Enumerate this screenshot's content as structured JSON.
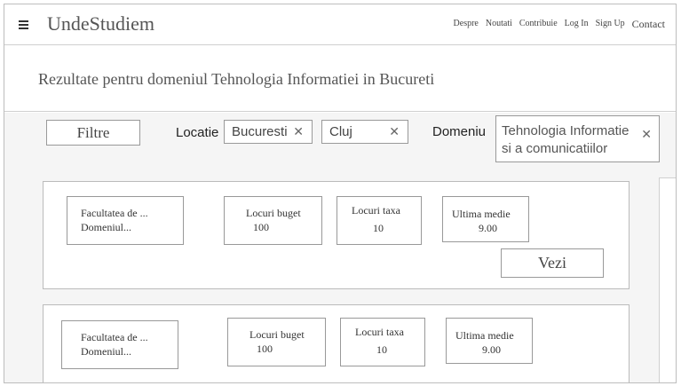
{
  "header": {
    "logo": "UndeStudiem",
    "nav": [
      "Despre",
      "Noutati",
      "Contribuie",
      "Log In",
      "Sign Up",
      "Contact"
    ]
  },
  "results_title": "Rezultate pentru domeniul Tehnologia Informatiei in Bucureti",
  "filters": {
    "button_label": "Filtre",
    "location_label": "Locatie",
    "locations": [
      "Bucuresti",
      "Cluj"
    ],
    "domain_label": "Domeniu",
    "domain_line1": "Tehnologia Informatie",
    "domain_line2": "si a comunicatiilor",
    "remove_glyph": "✕"
  },
  "cards": [
    {
      "faculty_line1": "Facultatea de ...",
      "faculty_line2": "Domeniul...",
      "budget_label": "Locuri buget",
      "budget_value": "100",
      "tax_label": "Locuri taxa",
      "tax_value": "10",
      "avg_label": "Ultima medie",
      "avg_value": "9.00",
      "view_label": "Vezi"
    },
    {
      "faculty_line1": "Facultatea de ...",
      "faculty_line2": "Domeniul...",
      "budget_label": "Locuri buget",
      "budget_value": "100",
      "tax_label": "Locuri taxa",
      "tax_value": "10",
      "avg_label": "Ultima medie",
      "avg_value": "9.00"
    }
  ]
}
